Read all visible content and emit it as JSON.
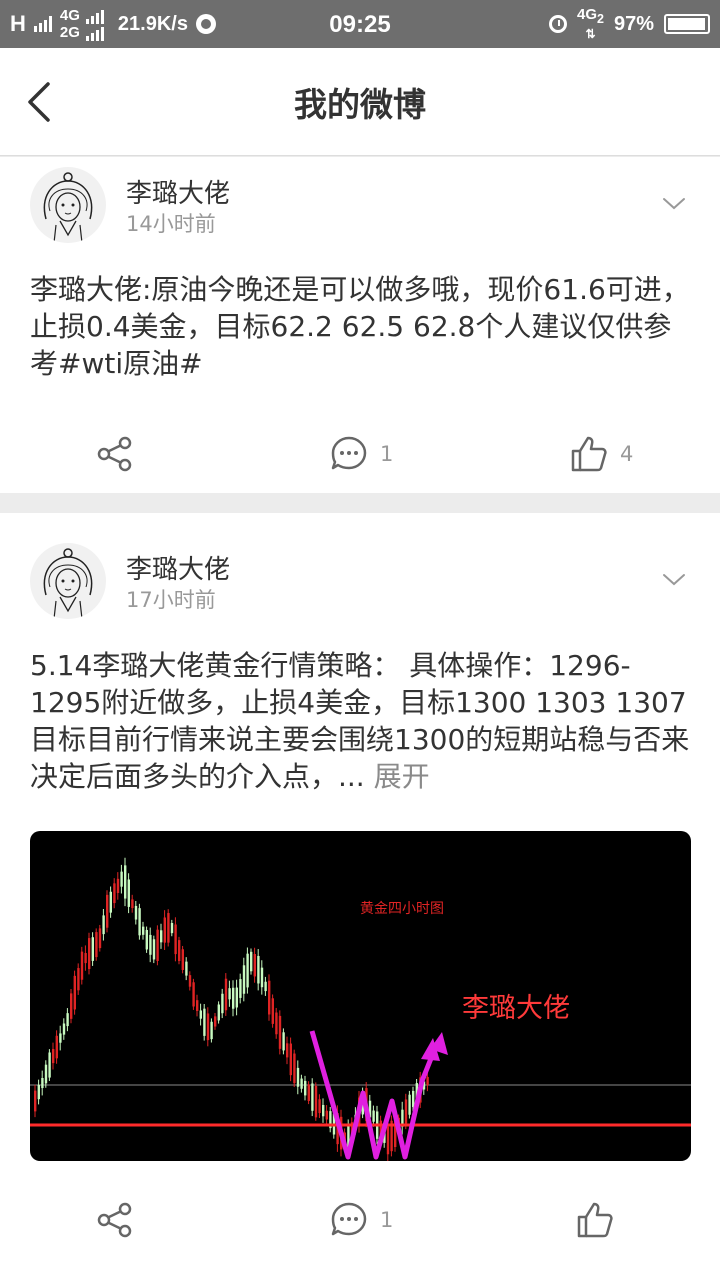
{
  "status_bar": {
    "carrier": "H",
    "net_top": "4G",
    "net_bottom": "2G",
    "speed": "21.9K/s",
    "time": "09:25",
    "net_right": "4G",
    "net_right_sub": "2",
    "battery": "97%",
    "battery_level": 0.97
  },
  "header": {
    "title": "我的微博",
    "back_icon": "chevron-left-icon"
  },
  "posts": [
    {
      "author": "李璐大佬",
      "time": "14小时前",
      "text": "李璐大佬:原油今晚还是可以做多哦，现价61.6可进，止损0.4美金，目标62.2 62.5 62.8个人建议仅供参考#wti原油#",
      "comments": "1",
      "likes": "4"
    },
    {
      "author": "李璐大佬",
      "time": "17小时前",
      "text": "5.14李璐大佬黄金行情策略： 具体操作：1296-1295附近做多，止损4美金，目标1300 1303 1307 目标目前行情来说主要会围绕1300的短期站稳与否来决定后面多头的介入点，... ",
      "expand": "展开",
      "comments": "1",
      "likes": "",
      "image": {
        "caption": "黄金四小时图",
        "watermark": "李璐大佬"
      }
    }
  ],
  "colors": {
    "status_bar": "#6e6e6e",
    "background": "#ececec",
    "chart_bg": "#000000",
    "candle_up": "#c8fac0",
    "candle_down": "#e02424",
    "arrow": "#e020e0"
  }
}
